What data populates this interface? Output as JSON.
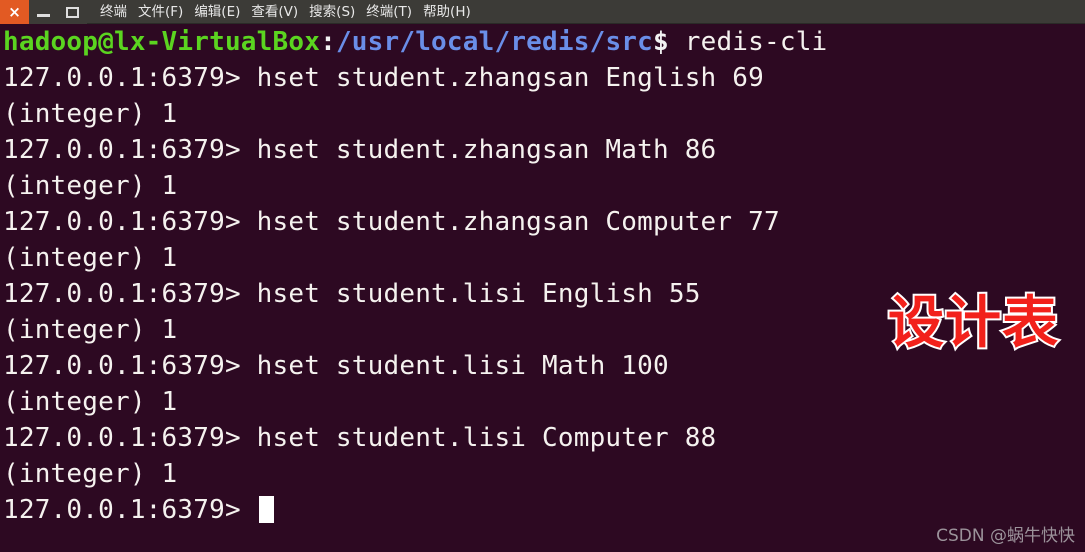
{
  "window": {
    "buttons": {
      "close": "×",
      "minimize": "—",
      "maximize": "□"
    },
    "menu": [
      "终端",
      "文件(F)",
      "编辑(E)",
      "查看(V)",
      "搜索(S)",
      "终端(T)",
      "帮助(H)"
    ]
  },
  "terminal": {
    "background_color": "#2d0922",
    "shell_prompt": {
      "user_host": "hadoop@lx-VirtualBox",
      "colon": ":",
      "path": "/usr/local/redis/src",
      "dollar": "$ ",
      "command": "redis-cli"
    },
    "redis_prompt": "127.0.0.1:6379> ",
    "lines": [
      {
        "type": "command",
        "prompt": "127.0.0.1:6379> ",
        "text": "hset student.zhangsan English 69"
      },
      {
        "type": "output",
        "prompt": "",
        "text": "(integer) 1"
      },
      {
        "type": "command",
        "prompt": "127.0.0.1:6379> ",
        "text": "hset student.zhangsan Math 86"
      },
      {
        "type": "output",
        "prompt": "",
        "text": "(integer) 1"
      },
      {
        "type": "command",
        "prompt": "127.0.0.1:6379> ",
        "text": "hset student.zhangsan Computer 77"
      },
      {
        "type": "output",
        "prompt": "",
        "text": "(integer) 1"
      },
      {
        "type": "command",
        "prompt": "127.0.0.1:6379> ",
        "text": "hset student.lisi English 55"
      },
      {
        "type": "output",
        "prompt": "",
        "text": "(integer) 1"
      },
      {
        "type": "command",
        "prompt": "127.0.0.1:6379> ",
        "text": "hset student.lisi Math 100"
      },
      {
        "type": "output",
        "prompt": "",
        "text": "(integer) 1"
      },
      {
        "type": "command",
        "prompt": "127.0.0.1:6379> ",
        "text": "hset student.lisi Computer 88"
      },
      {
        "type": "output",
        "prompt": "",
        "text": "(integer) 1"
      }
    ],
    "final_prompt": "127.0.0.1:6379> "
  },
  "watermarks": {
    "annotation": "设计表",
    "annotation_color": "#f2211b",
    "credit": "CSDN @蜗牛快快"
  }
}
